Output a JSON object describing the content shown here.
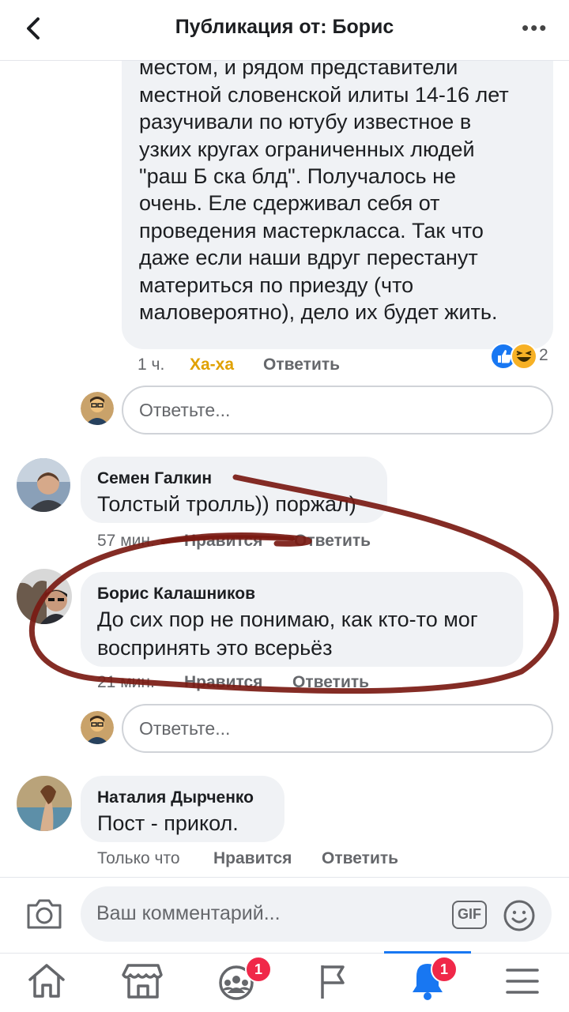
{
  "header": {
    "title": "Публикация от: Борис",
    "more": "•••"
  },
  "post": {
    "text": "Однажды я зависал где-то под Новым\nместом, и рядом представители\nместной словенской илиты 14-16 лет\nразучивали по ютубу известное в\nузких кругах ограниченных людей\n\"раш Б ска блд\". Получалось не\nочень. Еле сдерживал себя от\nпроведения мастеркласса. Так что\nдаже если наши вдруг перестанут\nматериться по приезду (что\nмаловероятно), дело их будет жить.",
    "time": "1 ч.",
    "reaction_label": "Ха-ха",
    "reply_label": "Ответить",
    "reaction_count": "2"
  },
  "reply_placeholder": "Ответьте...",
  "comments": [
    {
      "name": "Семен Галкин",
      "text": "Толстый тролль)) поржал)",
      "time": "57 мин.",
      "like": "Нравится",
      "reply": "Ответить"
    },
    {
      "name": "Борис Калашников",
      "text": "До сих пор не понимаю, как кто-то мог воспринять это всерьёз",
      "time": "21 мин.",
      "like": "Нравится",
      "reply": "Ответить"
    },
    {
      "name": "Наталия Дырченко",
      "text": "Пост - прикол.",
      "time": "Только что",
      "like": "Нравится",
      "reply": "Ответить"
    }
  ],
  "composer": {
    "placeholder": "Ваш комментарий...",
    "gif": "GIF"
  },
  "tabs": {
    "groups_badge": "1",
    "notifications_badge": "1"
  },
  "colors": {
    "accent": "#1877f2",
    "haha": "#e0a100",
    "annotation": "#7a1a12",
    "badge": "#f02849"
  }
}
